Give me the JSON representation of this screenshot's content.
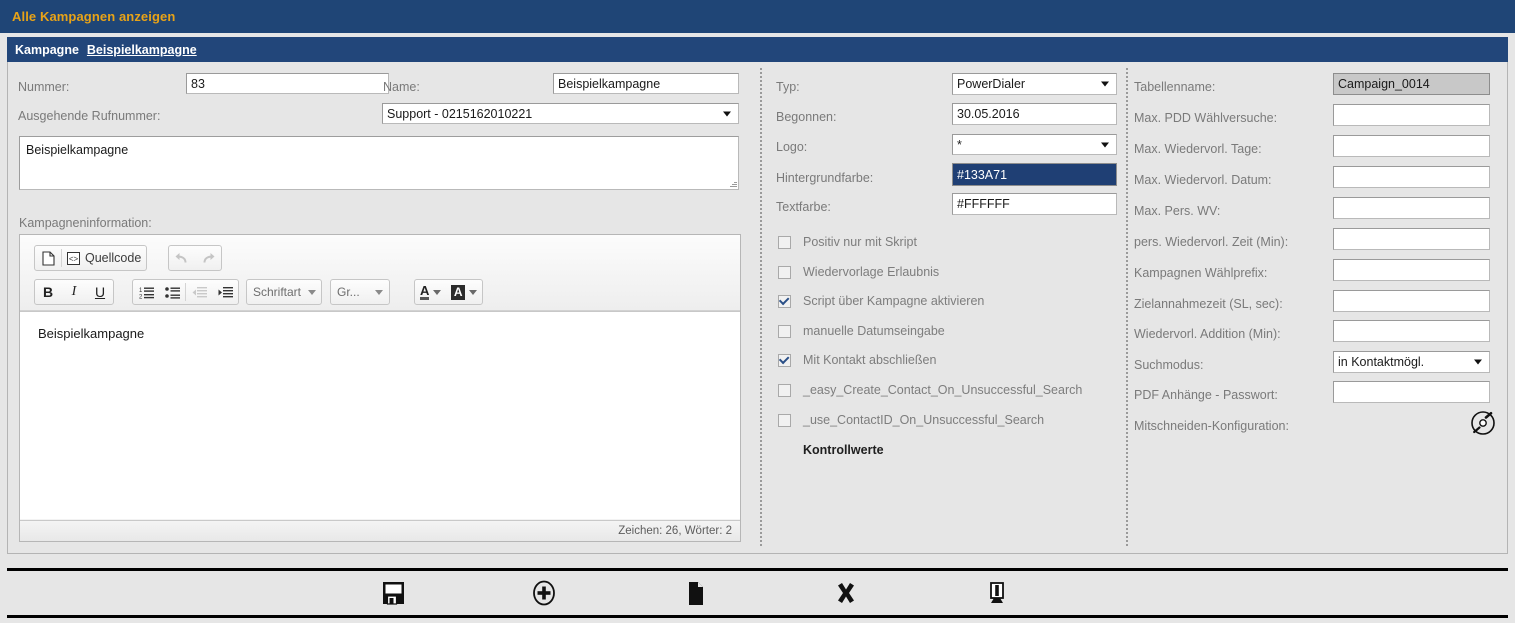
{
  "banner": {
    "title": "Alle Kampagnen anzeigen"
  },
  "section": {
    "label": "Kampagne",
    "link": "Beispielkampagne"
  },
  "colors": {
    "header_blue": "#1f4576",
    "header_accent_orange": "#e8a317",
    "selected_field_bg": "#133A71",
    "panel_bg": "#e6e6e6"
  },
  "left": {
    "nummer_label": "Nummer:",
    "nummer_value": "83",
    "name_label": "Name:",
    "name_value": "Beispielkampagne",
    "rufnummer_label": "Ausgehende Rufnummer:",
    "rufnummer_value": "Support - 0215162010221",
    "description_value": "Beispielkampagne",
    "info_label": "Kampagneninformation:",
    "editor": {
      "source_button": "Quellcode",
      "bold": "B",
      "italic": "I",
      "underline": "U",
      "font_combo": "Schriftart",
      "size_combo": "Gr...",
      "text_color": "A",
      "bg_color": "A",
      "content": "Beispielkampagne",
      "status": "Zeichen: 26, Wörter: 2"
    }
  },
  "middle": {
    "fields": [
      {
        "label": "Typ:",
        "value": "PowerDialer",
        "kind": "select"
      },
      {
        "label": "Begonnen:",
        "value": "30.05.2016",
        "kind": "text"
      },
      {
        "label": "Logo:",
        "value": "*",
        "kind": "select"
      },
      {
        "label": "Hintergrundfarbe:",
        "value": "#133A71",
        "kind": "text-selected"
      },
      {
        "label": "Textfarbe:",
        "value": "#FFFFFF",
        "kind": "text"
      }
    ],
    "checkboxes": [
      {
        "label": "Positiv nur mit Skript",
        "checked": false
      },
      {
        "label": "Wiedervorlage Erlaubnis",
        "checked": false
      },
      {
        "label": "Script über Kampagne aktivieren",
        "checked": true
      },
      {
        "label": "manuelle Datumseingabe",
        "checked": false
      },
      {
        "label": "Mit Kontakt abschließen",
        "checked": true
      },
      {
        "label": "_easy_Create_Contact_On_Unsuccessful_Search",
        "checked": false
      },
      {
        "label": "_use_ContactID_On_Unsuccessful_Search",
        "checked": false
      }
    ],
    "kontrollwerte": "Kontrollwerte"
  },
  "right": {
    "fields": [
      {
        "label": "Tabellenname:",
        "value": "Campaign_0014",
        "kind": "readonly"
      },
      {
        "label": "Max. PDD Wählversuche:",
        "value": "",
        "kind": "text"
      },
      {
        "label": "Max. Wiedervorl. Tage:",
        "value": "",
        "kind": "text"
      },
      {
        "label": "Max. Wiedervorl. Datum:",
        "value": "",
        "kind": "text"
      },
      {
        "label": "Max. Pers. WV:",
        "value": "",
        "kind": "text"
      },
      {
        "label": "pers. Wiedervorl. Zeit (Min):",
        "value": "",
        "kind": "text"
      },
      {
        "label": "Kampagnen Wählprefix:",
        "value": "",
        "kind": "text"
      },
      {
        "label": "Zielannahmezeit (SL, sec):",
        "value": "",
        "kind": "text"
      },
      {
        "label": "Wiedervorl. Addition (Min):",
        "value": "",
        "kind": "text"
      },
      {
        "label": "Suchmodus:",
        "value": "in Kontaktmögl.",
        "kind": "select"
      },
      {
        "label": "PDF Anhänge - Passwort:",
        "value": "",
        "kind": "text"
      },
      {
        "label": "Mitschneiden-Konfiguration:",
        "value": "",
        "kind": "icon"
      }
    ]
  },
  "bottom_toolbar": {
    "buttons": [
      {
        "icon": "save-floppy-icon",
        "name": "save-button"
      },
      {
        "icon": "add-circle-icon",
        "name": "add-button"
      },
      {
        "icon": "document-icon",
        "name": "new-document-button"
      },
      {
        "icon": "close-x-icon",
        "name": "delete-button"
      },
      {
        "icon": "monitor-icon",
        "name": "monitor-button"
      }
    ]
  }
}
